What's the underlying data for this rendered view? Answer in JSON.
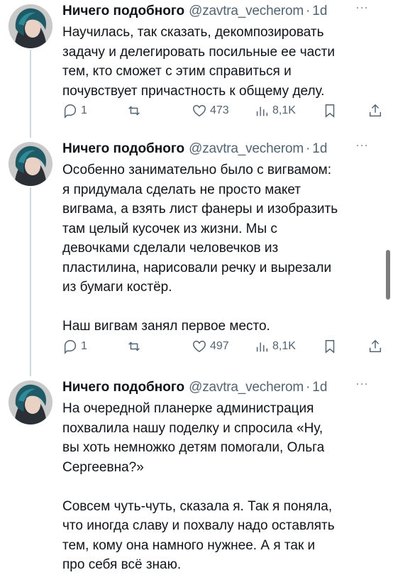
{
  "tweets": [
    {
      "name": "Ничего подобного",
      "handle": "@zavtra_vecherom",
      "dot": "·",
      "time": "1d",
      "more_label": "···",
      "text": "Научилась, так сказать, декомпозировать\nзадачу и делегировать посильные ее части\nтем, кто сможет с этим справиться и\nпочувствует причастность к общему делу.",
      "replies": "1",
      "retweets": "",
      "likes": "473",
      "views": "8,1K"
    },
    {
      "name": "Ничего подобного",
      "handle": "@zavtra_vecherom",
      "dot": "·",
      "time": "1d",
      "more_label": "···",
      "text": "Особенно занимательно было с вигвамом:\nя придумала сделать не просто макет\nвигвама, а взять лист фанеры и изобразить\nтам целый кусочек из жизни. Мы с\nдевочками сделали человечков из\nпластилина, нарисовали речку и вырезали\nиз бумаги костёр.\n\nНаш вигвам занял первое место.",
      "replies": "1",
      "retweets": "",
      "likes": "497",
      "views": "8,1K"
    },
    {
      "name": "Ничего подобного",
      "handle": "@zavtra_vecherom",
      "dot": "·",
      "time": "1d",
      "more_label": "···",
      "text": "На очередной планерке администрация\nпохвалила нашу поделку и спросила «Ну,\nвы хоть немножко детям помогали, Ольга\nСергеевна?»\n\nСовсем чуть-чуть, сказала я. Так я поняла,\nчто иногда славу и похвалу надо оставлять\nтем, кому она намного нужнее. А я так и\nпро себя всё знаю."
    }
  ],
  "colors": {
    "text": "#0f1419",
    "secondary": "#536471",
    "thread_line": "#cfd9de",
    "avatar_hair": "#1f5a66"
  },
  "icons": [
    "reply-icon",
    "retweet-icon",
    "like-icon",
    "views-icon",
    "bookmark-icon",
    "share-icon",
    "more-icon"
  ]
}
